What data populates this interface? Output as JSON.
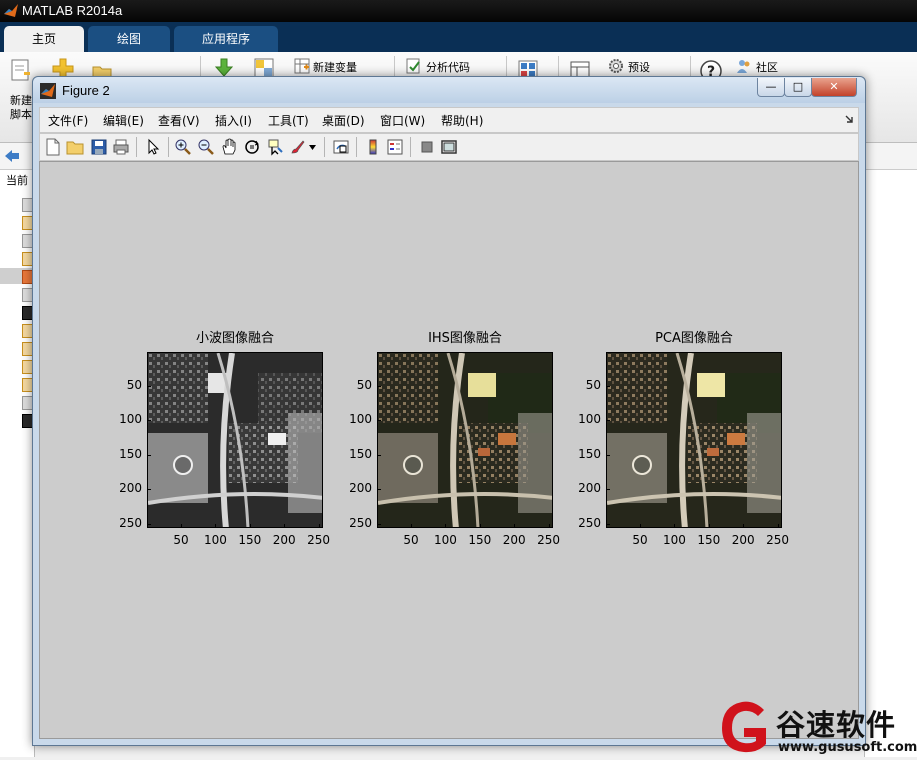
{
  "app": {
    "title": "MATLAB R2014a"
  },
  "main_tabs": [
    {
      "label": "主页",
      "active": true
    },
    {
      "label": "绘图",
      "active": false
    },
    {
      "label": "应用程序",
      "active": false
    }
  ],
  "ribbon": {
    "new_script_line1": "新建",
    "new_script_line2": "脚本",
    "new_variable": "新建变量",
    "analyze_code": "分析代码",
    "preferences": "预设",
    "community": "社区"
  },
  "left_panel": {
    "header": "当前"
  },
  "figure": {
    "title": "Figure 2",
    "window_buttons": {
      "minimize": "—",
      "maximize": "□",
      "close": "✕"
    },
    "menus": [
      "文件(F)",
      "编辑(E)",
      "查看(V)",
      "插入(I)",
      "工具(T)",
      "桌面(D)",
      "窗口(W)",
      "帮助(H)"
    ],
    "toolbar_icons": [
      "new-figure-icon",
      "open-file-icon",
      "save-icon",
      "print-icon",
      "select-arrow-icon",
      "zoom-in-icon",
      "zoom-out-icon",
      "pan-hand-icon",
      "rotate-3d-icon",
      "data-cursor-icon",
      "brush-icon",
      "link-plot-icon",
      "colorbar-icon",
      "legend-icon",
      "hide-plot-tools-icon",
      "show-plot-tools-icon"
    ],
    "axes": [
      {
        "title": "小波图像融合",
        "style": "grayscale"
      },
      {
        "title": "IHS图像融合",
        "style": "color"
      },
      {
        "title": "PCA图像融合",
        "style": "color"
      }
    ],
    "x_ticks": [
      "50",
      "100",
      "150",
      "200",
      "250"
    ],
    "y_ticks": [
      "50",
      "100",
      "150",
      "200",
      "250"
    ],
    "x_tick_values": [
      50,
      100,
      150,
      200,
      250
    ],
    "y_tick_values": [
      50,
      100,
      150,
      200,
      250
    ],
    "axis_range": [
      0.5,
      256.5
    ]
  },
  "watermark": {
    "brand": "谷速软件",
    "url": "www.gususoft.com"
  },
  "colors": {
    "canvas_gray": "#cccccc",
    "figure_frame": "#c9d9ea",
    "main_tab_bar": "#0a2f55",
    "watermark_red": "#d0121b"
  }
}
